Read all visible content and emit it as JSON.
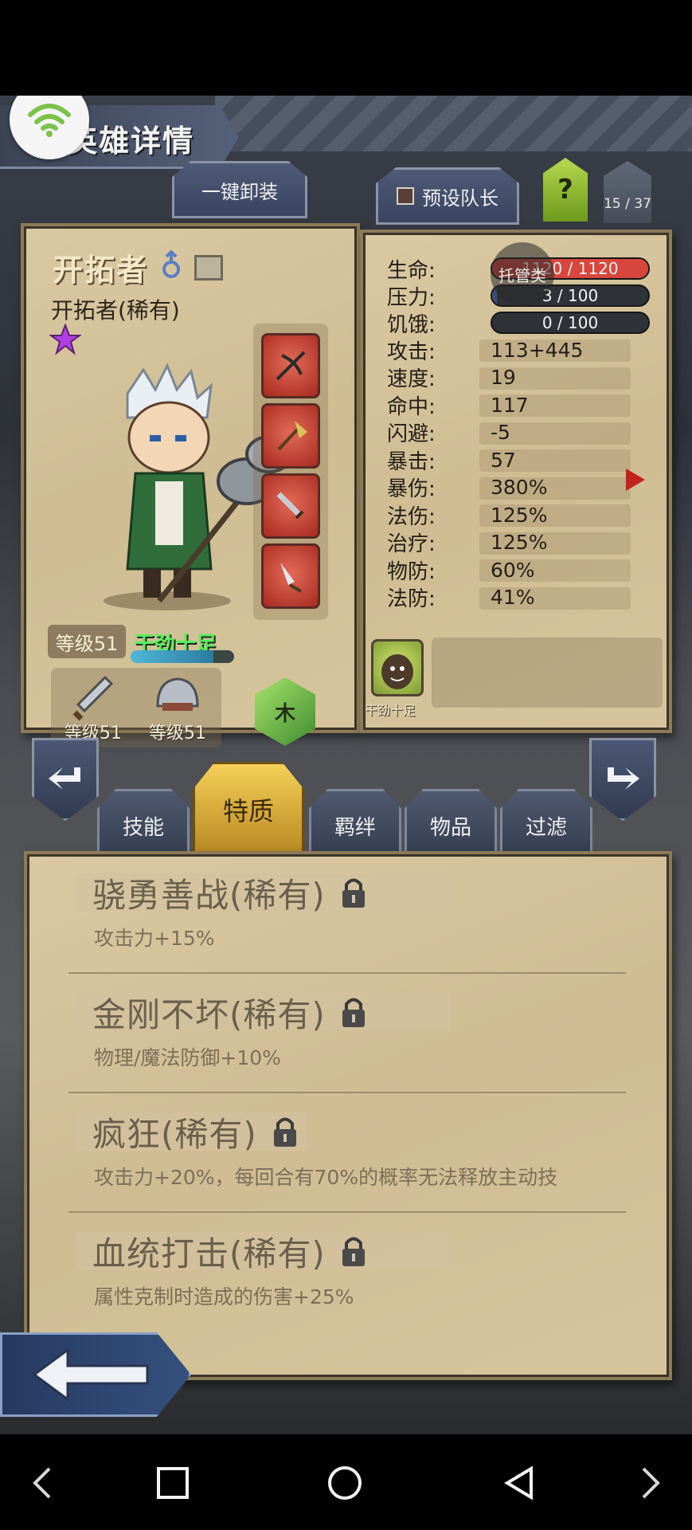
{
  "screen": {
    "title": "英雄详情",
    "wifi_icon": "wifi-icon"
  },
  "top_buttons": {
    "unequip_all": "一键卸装",
    "preset_leader": "预设队长",
    "help": "?",
    "hero_count": "15 / 37"
  },
  "hero": {
    "name": "开拓者",
    "subtitle": "开拓者(稀有)",
    "gender_icon": "male-icon",
    "rarity_icon": "purple-star-icon",
    "level": "等级51",
    "status": "干劲十足",
    "energy_fraction": 0.8,
    "element": "木",
    "gear": [
      {
        "icon": "sword-icon",
        "label": "等级51"
      },
      {
        "icon": "helmet-icon",
        "label": "等级51"
      }
    ],
    "equipment_slots": [
      "crossbow-icon",
      "axe-icon",
      "sword-icon",
      "dagger-icon"
    ]
  },
  "stats": {
    "hp": {
      "label": "生命:",
      "value": "1120 / 1120",
      "fraction": 1.0,
      "color": "#d8463d"
    },
    "hp_overlay": "托管类",
    "stress": {
      "label": "压力:",
      "value": "3 / 100",
      "fraction": 0.03,
      "color": "#3c4f7a"
    },
    "hunger": {
      "label": "饥饿:",
      "value": "0 / 100",
      "fraction": 0.0,
      "color": "#3c4f7a"
    },
    "rows": [
      {
        "label": "攻击:",
        "value": "113+445"
      },
      {
        "label": "速度:",
        "value": "19"
      },
      {
        "label": "命中:",
        "value": "117"
      },
      {
        "label": "闪避:",
        "value": "-5"
      },
      {
        "label": "暴击:",
        "value": "57"
      },
      {
        "label": "暴伤:",
        "value": "380%"
      },
      {
        "label": "法伤:",
        "value": "125%"
      },
      {
        "label": "治疗:",
        "value": "125%"
      },
      {
        "label": "物防:",
        "value": "60%"
      },
      {
        "label": "法防:",
        "value": "41%"
      }
    ],
    "trait_card_label": "干劲十足"
  },
  "tabs": [
    {
      "label": "技能",
      "active": false
    },
    {
      "label": "特质",
      "active": true
    },
    {
      "label": "羁绊",
      "active": false
    },
    {
      "label": "物品",
      "active": false
    },
    {
      "label": "过滤",
      "active": false
    }
  ],
  "traits": [
    {
      "title": "骁勇善战(稀有)",
      "desc": "攻击力+15%"
    },
    {
      "title": "金刚不坏(稀有)",
      "desc": "物理/魔法防御+10%"
    },
    {
      "title": "疯狂(稀有)",
      "desc": "攻击力+20%，每回合有70%的概率无法释放主动技"
    },
    {
      "title": "血统打击(稀有)",
      "desc": "属性克制时造成的伤害+25%"
    }
  ],
  "system_nav": [
    "back-chevron-icon",
    "square-icon",
    "circle-icon",
    "triangle-back-icon",
    "forward-chevron-icon"
  ]
}
